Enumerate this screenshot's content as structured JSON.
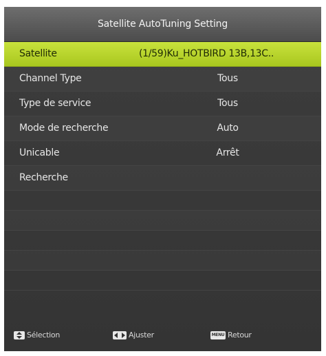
{
  "window": {
    "title": "Satellite AutoTuning Setting"
  },
  "menu": {
    "rows": [
      {
        "label": "Satellite",
        "value": "(1/59)Ku_HOTBIRD 13B,13C..",
        "selected": true
      },
      {
        "label": "Channel Type",
        "value": "Tous"
      },
      {
        "label": "Type de service",
        "value": "Tous"
      },
      {
        "label": "Mode de recherche",
        "value": "Auto"
      },
      {
        "label": "Unicable",
        "value": "Arrêt"
      },
      {
        "label": "Recherche",
        "value": ""
      }
    ]
  },
  "footer": {
    "select_label": "Sélection",
    "adjust_label": "Ajuster",
    "back_label": "Retour",
    "menu_key_text": "MENU"
  },
  "colors": {
    "highlight": "#b6d22a",
    "panel": "#3a3a3a",
    "title_bar": "#5a5a5a"
  },
  "icons": {
    "select": "up-down-arrows-icon",
    "adjust": "left-right-arrows-icon",
    "back": "menu-key-icon"
  }
}
